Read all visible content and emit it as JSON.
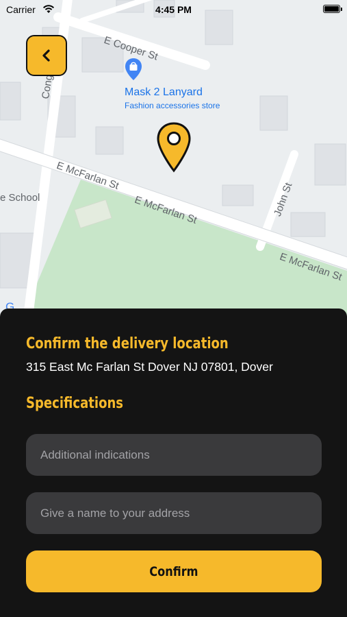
{
  "status_bar": {
    "carrier": "Carrier",
    "time": "4:45 PM"
  },
  "map": {
    "streets": {
      "e_cooper": "E Cooper St",
      "e_mcfarlan_1": "E McFarlan St",
      "e_mcfarlan_2": "E McFarlan St",
      "e_mcfarlan_3": "E McFarlan St",
      "john": "John St",
      "cong": "Cong"
    },
    "school_label": "e School",
    "poi": {
      "title": "Mask 2 Lanyard",
      "subtitle": "Fashion accessories store"
    },
    "google_logo_partial": "G"
  },
  "sheet": {
    "title": "Confirm the delivery location",
    "address": "315 East Mc Farlan St Dover NJ 07801, Dover",
    "spec_title": "Specifications",
    "field_indications_placeholder": "Additional indications",
    "field_name_placeholder": "Give a name to your address",
    "confirm_label": "Confirm"
  },
  "colors": {
    "accent": "#f6b92b",
    "sheet_bg": "#141414",
    "field_bg": "#3a3a3c",
    "poi_blue": "#1a73e8",
    "park_green": "#c8e6c9"
  },
  "icons": {
    "back": "chevron-left-icon",
    "wifi": "wifi-icon",
    "battery": "battery-icon",
    "poi": "shopping-bag-pin-icon",
    "location": "location-pin-icon"
  }
}
